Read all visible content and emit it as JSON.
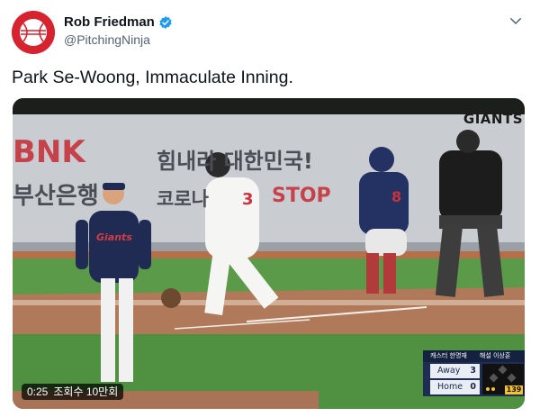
{
  "tweet": {
    "display_name": "Rob Friedman",
    "handle": "@PitchingNinja",
    "text": "Park Se-Woong, Immaculate Inning."
  },
  "icons": {
    "avatar": "baseball-avatar",
    "verified": "verified-badge-icon",
    "menu": "chevron-down-icon"
  },
  "video": {
    "duration": "0:25",
    "views": "조회수 10만회",
    "banner": {
      "bnk": "BNK",
      "slogan": "힘내라 대한민국!",
      "bank": "부산은행",
      "corona": "코로나",
      "stop": "STOP"
    },
    "giants_logo": "GIANTS",
    "jersey_text": "Giants",
    "scoreboard": {
      "caster": "캐스터 한명재",
      "commentator": "해설 이상훈",
      "away_label": "Away",
      "away_score": "3",
      "home_label": "Home",
      "home_score": "0",
      "pitch_count": "139"
    }
  },
  "colors": {
    "avatar_red": "#d52330",
    "verified_blue": "#1d9bf0",
    "scoreboard_navy": "#1f2d52"
  }
}
